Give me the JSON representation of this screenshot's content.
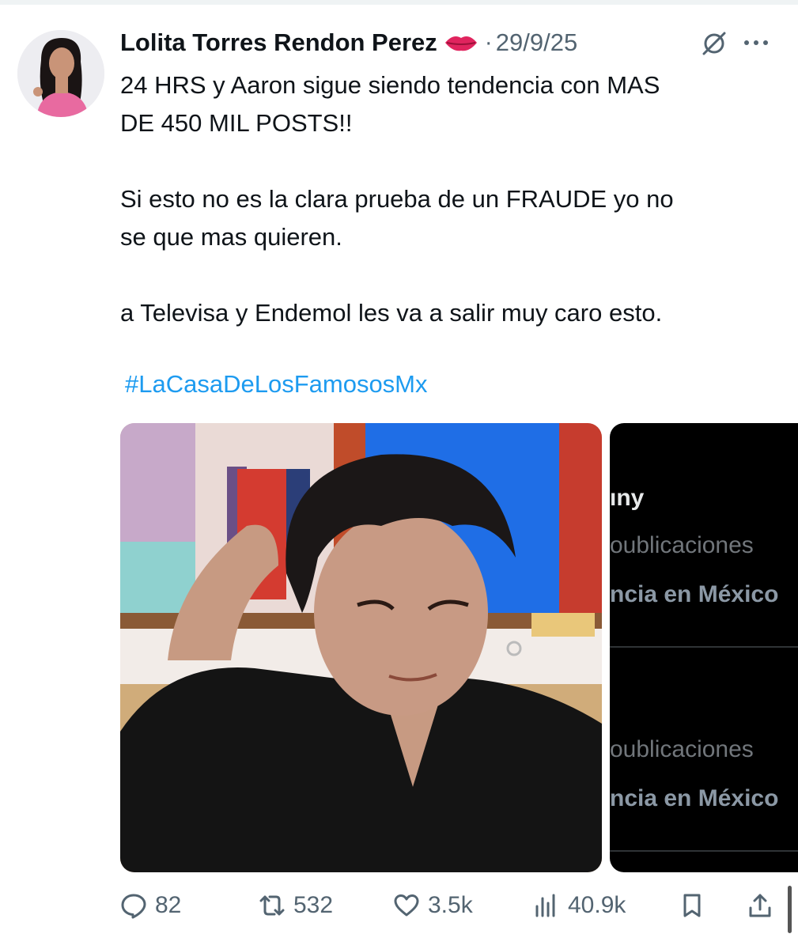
{
  "post": {
    "author_name": "Lolita Torres Rendon Perez",
    "emoji_icon": "lips-icon",
    "separator": "·",
    "date": "29/9/25",
    "lines_para1": [
      "24 HRS y Aaron sigue siendo tendencia con MAS",
      "DE 450 MIL POSTS!!"
    ],
    "lines_para2": [
      "Si esto no es la clara prueba de un FRAUDE yo no",
      "se que mas quieren."
    ],
    "lines_para3": [
      "a Televisa y Endemol les va a salir muy caro esto."
    ],
    "hashtag": "#LaCasaDeLosFamososMx"
  },
  "media2": {
    "title_fragment": "ıny",
    "rows": [
      {
        "count_fragment": "oublicaciones",
        "trend_fragment": "ncia en México"
      },
      {
        "count_fragment": "oublicaciones",
        "trend_fragment": "ncia en México"
      }
    ]
  },
  "actions": {
    "replies": "82",
    "reposts": "532",
    "likes": "3.5k",
    "views": "40.9k"
  },
  "colors": {
    "text": "#0f1419",
    "secondary": "#536471",
    "link": "#1d9bf0"
  }
}
